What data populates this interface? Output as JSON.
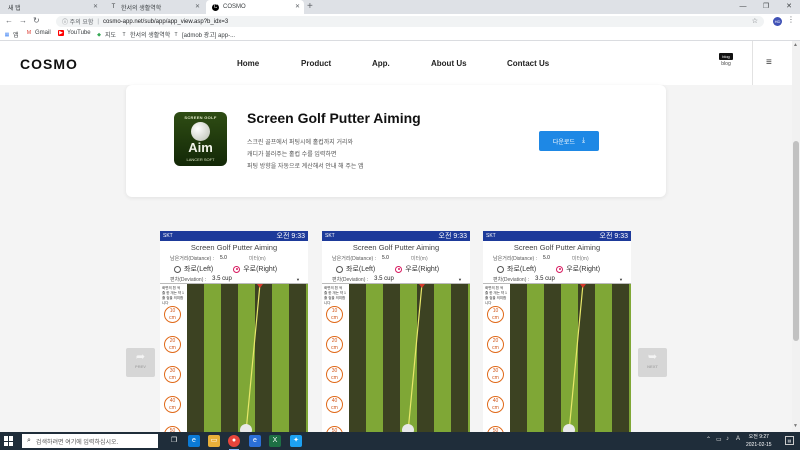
{
  "browser": {
    "tabs": [
      {
        "label": "새 탭",
        "favicon": "blank"
      },
      {
        "label": "한서의 생활역학",
        "favicon": "T"
      },
      {
        "label": "COSMO",
        "favicon": "C"
      }
    ],
    "new_tab": "+",
    "window_controls": {
      "minimize": "—",
      "maximize": "❐",
      "close": "✕"
    },
    "address": {
      "security": "주의 요함",
      "url": "cosmo-app.net/sub/app/app_view.asp?b_idx=3"
    },
    "profile_initials": "HD",
    "bookmarks": [
      {
        "label": "앱",
        "icon": "apps-icon"
      },
      {
        "label": "Gmail",
        "icon": "gmail-icon"
      },
      {
        "label": "YouTube",
        "icon": "youtube-icon"
      },
      {
        "label": "지도",
        "icon": "maps-icon"
      },
      {
        "label": "한서의 생활역학",
        "icon": "T"
      },
      {
        "label": "[admob 광고] app-...",
        "icon": "T"
      }
    ]
  },
  "site": {
    "logo": "COSMO",
    "nav": [
      "Home",
      "Product",
      "App.",
      "About Us",
      "Contact Us"
    ],
    "blog_icon_text": "blog",
    "blog_label": "blog"
  },
  "app": {
    "icon": {
      "title": "SCREEN GOLF",
      "center": "Aim",
      "maker": "LANCER SOFT"
    },
    "title": "Screen Golf Putter Aiming",
    "description": [
      "스크린 골프에서 퍼팅시에 홀컵까지 거리와",
      "캐디가 불러주는 홀컵 수를 입력하면",
      "퍼팅 방향을 자동으로 계산해서 안내 해 주는 앱"
    ],
    "download_label": "다운로드"
  },
  "carousel": {
    "prev": "PREV",
    "next": "NEXT",
    "screens": [
      {
        "carrier": "SKT",
        "time": "오전 9:33",
        "app_title": "Screen Golf Putter Aiming",
        "distance_label": "남은거리(Distance) :",
        "distance_value": "5.0",
        "distance_unit": "미터(m)",
        "left_label": "좌로(Left)",
        "right_label": "우로(Right)",
        "selected": "right",
        "deviation_label": "편차(Deviation) :",
        "deviation_value": "3.5 cup",
        "side_note": "화면의 흰 색 줄 한 개는 약 1 홀 컵을 의미합니다",
        "distances": [
          "10",
          "20",
          "30",
          "40",
          "50"
        ],
        "dist_unit": "cm"
      },
      {
        "carrier": "SKT",
        "time": "오전 9:33",
        "app_title": "Screen Golf Putter Aiming",
        "distance_label": "남은거리(Distance) :",
        "distance_value": "5.0",
        "distance_unit": "미터(m)",
        "left_label": "좌로(Left)",
        "right_label": "우로(Right)",
        "selected": "right",
        "deviation_label": "편차(Deviation) :",
        "deviation_value": "3.5 cup",
        "side_note": "화면의 흰 색 줄 한 개는 약 1 홀 컵을 의미합니다",
        "distances": [
          "10",
          "20",
          "30",
          "40",
          "50"
        ],
        "dist_unit": "cm"
      },
      {
        "carrier": "SKT",
        "time": "오전 9:33",
        "app_title": "Screen Golf Putter Aiming",
        "distance_label": "남은거리(Distance) :",
        "distance_value": "5.0",
        "distance_unit": "미터(m)",
        "left_label": "좌로(Left)",
        "right_label": "우로(Right)",
        "selected": "right",
        "deviation_label": "편차(Deviation) :",
        "deviation_value": "3.5 cup",
        "side_note": "화면의 흰 색 줄 한 개는 약 1 홀 컵을 의미합니다",
        "distances": [
          "10",
          "20",
          "30",
          "40",
          "50"
        ],
        "dist_unit": "cm"
      }
    ]
  },
  "taskbar": {
    "search_placeholder": "검색하려면 여기에 입력하십시오.",
    "apps": [
      "task-view-icon",
      "edge-icon",
      "file-explorer-icon",
      "chrome-icon",
      "ie-icon",
      "excel-icon",
      "twitter-icon"
    ],
    "time": "오전 9:27",
    "date": "2021-02-15"
  },
  "colors": {
    "accent": "#1e88e5",
    "android_status": "#1d3a9a",
    "green_dark": "#3c4222",
    "green_light": "#7fa736",
    "aim_line": "#e8e86a",
    "distance_marker": "#e06a1a",
    "taskbar": "#1f2d3a"
  }
}
